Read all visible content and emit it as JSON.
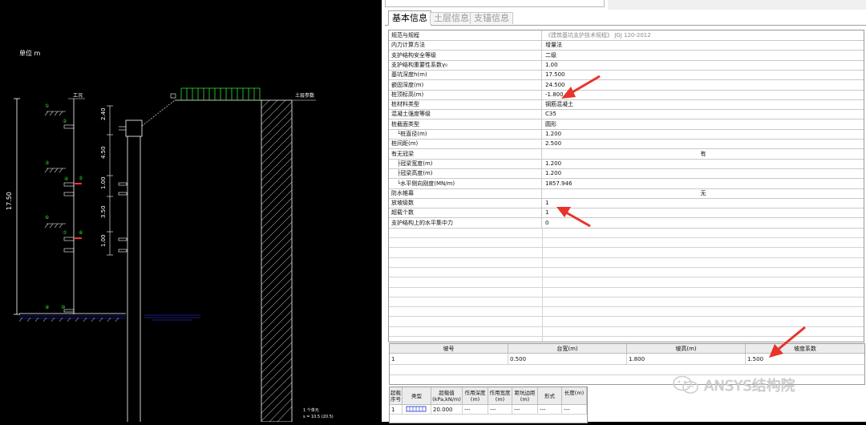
{
  "cad": {
    "unit_label": "单位 m",
    "left_label": "工况",
    "right_label": "土层参数",
    "total_depth_label": "17.50",
    "segment_labels": [
      "2.40",
      "4.50",
      "1.00",
      "3.50",
      "1.00"
    ],
    "stage_numbers": [
      "①",
      "②",
      "③",
      "④",
      "⑤",
      "⑥",
      "⑦",
      "⑧",
      "⑨",
      "⑩"
    ],
    "bottom_note": "1 个单元",
    "bottom_note2": "s = 10.5 (20.5)"
  },
  "tabs": [
    {
      "label": "基本信息",
      "active": true
    },
    {
      "label": "土层信息",
      "active": false
    },
    {
      "label": "支锚信息",
      "active": false
    }
  ],
  "properties": [
    {
      "label": "规范与规程",
      "value": "《建筑基坑支护技术规程》 JGJ 120-2012",
      "style": "grey"
    },
    {
      "label": "内力计算方法",
      "value": "增量法"
    },
    {
      "label": "支护结构安全等级",
      "value": "二级"
    },
    {
      "label": "支护结构重要性系数γ₀",
      "value": "1.00"
    },
    {
      "label": "基坑深度h(m)",
      "value": "17.500"
    },
    {
      "label": "嵌固深度(m)",
      "value": "24.500"
    },
    {
      "label": "桩顶标高(m)",
      "value": "-1.800"
    },
    {
      "label": "桩材料类型",
      "value": "钢筋混凝土"
    },
    {
      "label": "混凝土强度等级",
      "value": "C35"
    },
    {
      "label": "桩截面类型",
      "value": "圆形"
    },
    {
      "label": "└桩直径(m)",
      "value": "1.200",
      "indent": true
    },
    {
      "label": "桩间距(m)",
      "value": "2.500"
    },
    {
      "label": "有无冠梁",
      "value": "有",
      "style": "center"
    },
    {
      "label": "├冠梁宽度(m)",
      "value": "1.200",
      "indent": true
    },
    {
      "label": "├冠梁高度(m)",
      "value": "1.200",
      "indent": true
    },
    {
      "label": "└水平侧向刚度(MN/m)",
      "value": "1857.946",
      "indent": true
    },
    {
      "label": "防水帷幕",
      "value": "无",
      "style": "center"
    },
    {
      "label": "放坡级数",
      "value": "1"
    },
    {
      "label": "超载个数",
      "value": "1"
    },
    {
      "label": "支护结构上的水平集中力",
      "value": "0"
    }
  ],
  "slope_table": {
    "headers": [
      "坡号",
      "台宽(m)",
      "坡高(m)",
      "坡度系数"
    ],
    "rows": [
      [
        "1",
        "0.500",
        "1.800",
        "1.500"
      ]
    ]
  },
  "load_table": {
    "headers": [
      "超载序号",
      "类型",
      "超载值(kPa,kN/m)",
      "作用深度(m)",
      "作用宽度(m)",
      "距坑边距(m)",
      "形式",
      "长度(m)"
    ],
    "rows": [
      [
        "1",
        "",
        "20.000",
        "---",
        "---",
        "---",
        "---",
        "---"
      ]
    ]
  },
  "watermark": {
    "text": "ANSYS结构院"
  },
  "colors": {
    "accent_arrow": "#e8342a",
    "cad_bg": "#000000",
    "cad_line": "#ffffff",
    "cad_green": "#2fe52f"
  }
}
